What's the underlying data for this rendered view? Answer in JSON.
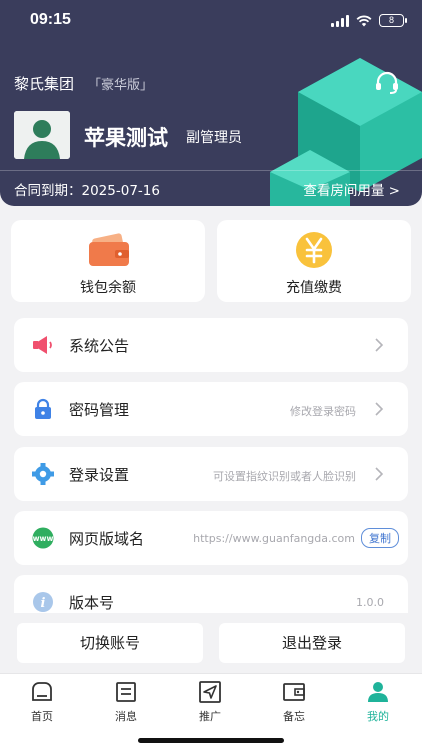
{
  "status_bar": {
    "time": "09:15",
    "battery": "8"
  },
  "header": {
    "company": "黎氏集团",
    "edition": "「豪华版」",
    "user_name": "苹果测试",
    "user_role": "副管理员",
    "contract_text": "合同到期：2025-07-16",
    "room_usage_link": "查看房间用量 >"
  },
  "quick_actions": [
    {
      "label": "钱包余额",
      "icon": "wallet-icon"
    },
    {
      "label": "充值缴费",
      "icon": "yuan-coin-icon"
    }
  ],
  "menu": {
    "announcement": {
      "label": "系统公告",
      "icon": "speaker-icon"
    },
    "password": {
      "label": "密码管理",
      "hint": "修改登录密码",
      "icon": "lock-icon"
    },
    "login_settings": {
      "label": "登录设置",
      "hint": "可设置指纹识别或者人脸识别",
      "icon": "gear-icon"
    },
    "domain": {
      "label": "网页版域名",
      "url": "https://www.guanfangda.com",
      "copy_label": "复制",
      "icon": "www-icon"
    },
    "version": {
      "label": "版本号",
      "value": "1.0.0",
      "icon": "info-icon"
    }
  },
  "bottom_actions": {
    "switch_account": "切换账号",
    "logout": "退出登录"
  },
  "tabs": [
    {
      "label": "首页",
      "icon": "home-icon"
    },
    {
      "label": "消息",
      "icon": "message-icon"
    },
    {
      "label": "推广",
      "icon": "send-icon"
    },
    {
      "label": "备忘",
      "icon": "memo-icon"
    },
    {
      "label": "我的",
      "icon": "profile-icon",
      "active": true
    }
  ],
  "colors": {
    "header_bg": "#3a3d5c",
    "accent": "#1fb39a",
    "link_blue": "#3f74cf"
  }
}
